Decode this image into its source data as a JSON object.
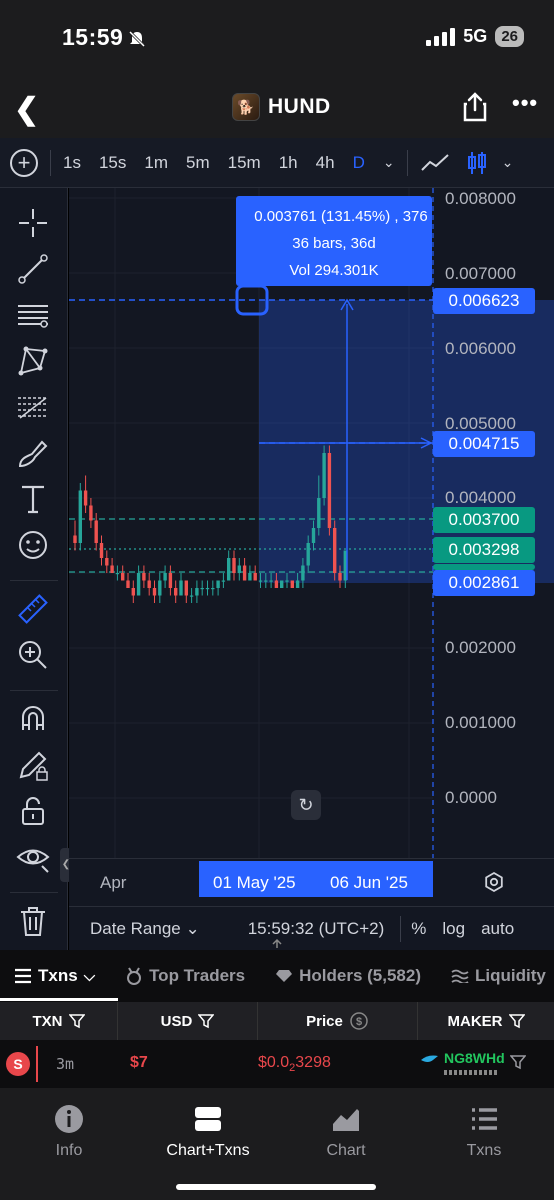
{
  "status": {
    "time": "15:59",
    "network": "5G",
    "battery": "26"
  },
  "header": {
    "token_name": "HUND"
  },
  "timeframes": {
    "items": [
      "1s",
      "15s",
      "1m",
      "5m",
      "15m",
      "1h",
      "4h",
      "D"
    ],
    "active": "D"
  },
  "chart": {
    "y_labels": [
      "0.008000",
      "0.007000",
      "0.006000",
      "0.005000",
      "0.004000",
      "0.002000",
      "0.001000",
      "0.0000"
    ],
    "price_tags": {
      "top": "0.006623",
      "mid": "0.004715",
      "green": "0.003700",
      "current": "0.003298",
      "bottom": "0.002861"
    },
    "measure": {
      "line1": "0.003761 (131.45%) , 376",
      "line2": "36 bars, 36d",
      "line3": "Vol 294.301K"
    },
    "x_labels": {
      "apr": "Apr",
      "start": "01 May '25",
      "end": "06 Jun '25"
    }
  },
  "chart_data": {
    "type": "candlestick",
    "ylim": [
      0,
      0.008
    ],
    "candles": [
      [
        0.0035,
        0.0037,
        0.0033,
        0.0034
      ],
      [
        0.0034,
        0.0042,
        0.0033,
        0.0041
      ],
      [
        0.0041,
        0.0043,
        0.0038,
        0.0039
      ],
      [
        0.0039,
        0.004,
        0.0036,
        0.0037
      ],
      [
        0.0037,
        0.0038,
        0.0033,
        0.0034
      ],
      [
        0.0034,
        0.0035,
        0.0031,
        0.0032
      ],
      [
        0.0032,
        0.0033,
        0.003,
        0.0031
      ],
      [
        0.0031,
        0.0032,
        0.003,
        0.003
      ],
      [
        0.003,
        0.0031,
        0.0029,
        0.003
      ],
      [
        0.003,
        0.0031,
        0.0029,
        0.0029
      ],
      [
        0.0029,
        0.003,
        0.0028,
        0.0028
      ],
      [
        0.0028,
        0.0029,
        0.0026,
        0.0027
      ],
      [
        0.0027,
        0.0031,
        0.0027,
        0.003
      ],
      [
        0.003,
        0.0031,
        0.0028,
        0.0029
      ],
      [
        0.0029,
        0.003,
        0.0027,
        0.0028
      ],
      [
        0.0028,
        0.0029,
        0.0026,
        0.0027
      ],
      [
        0.0027,
        0.003,
        0.0026,
        0.0029
      ],
      [
        0.0029,
        0.0031,
        0.0028,
        0.003
      ],
      [
        0.003,
        0.0031,
        0.0027,
        0.0028
      ],
      [
        0.0028,
        0.0029,
        0.0026,
        0.0027
      ],
      [
        0.0027,
        0.003,
        0.0027,
        0.0029
      ],
      [
        0.0029,
        0.0029,
        0.0026,
        0.0027
      ],
      [
        0.0027,
        0.0028,
        0.0026,
        0.0027
      ],
      [
        0.0027,
        0.0029,
        0.0026,
        0.0028
      ],
      [
        0.0028,
        0.0029,
        0.0027,
        0.0028
      ],
      [
        0.0028,
        0.0029,
        0.0027,
        0.0028
      ],
      [
        0.0028,
        0.0029,
        0.0027,
        0.0028
      ],
      [
        0.0028,
        0.0029,
        0.0027,
        0.0029
      ],
      [
        0.0029,
        0.003,
        0.0028,
        0.0029
      ],
      [
        0.0029,
        0.0033,
        0.0029,
        0.0032
      ],
      [
        0.0032,
        0.0033,
        0.0029,
        0.003
      ],
      [
        0.003,
        0.0032,
        0.0029,
        0.0031
      ],
      [
        0.0031,
        0.0032,
        0.0029,
        0.0029
      ],
      [
        0.0029,
        0.0031,
        0.0029,
        0.003
      ],
      [
        0.003,
        0.0031,
        0.0029,
        0.0029
      ],
      [
        0.0029,
        0.003,
        0.0028,
        0.0029
      ],
      [
        0.0029,
        0.003,
        0.0028,
        0.0029
      ],
      [
        0.0029,
        0.003,
        0.0028,
        0.0029
      ],
      [
        0.0029,
        0.003,
        0.0028,
        0.0028
      ],
      [
        0.0028,
        0.0029,
        0.0028,
        0.0029
      ],
      [
        0.0029,
        0.003,
        0.0028,
        0.0029
      ],
      [
        0.0029,
        0.0029,
        0.0028,
        0.0028
      ],
      [
        0.0028,
        0.003,
        0.0028,
        0.0029
      ],
      [
        0.0029,
        0.0032,
        0.0028,
        0.0031
      ],
      [
        0.0031,
        0.0035,
        0.003,
        0.0034
      ],
      [
        0.0034,
        0.0037,
        0.0033,
        0.0036
      ],
      [
        0.0036,
        0.0043,
        0.0035,
        0.004
      ],
      [
        0.004,
        0.0047,
        0.0039,
        0.0046
      ],
      [
        0.0046,
        0.0047,
        0.0035,
        0.0036
      ],
      [
        0.0036,
        0.0037,
        0.0029,
        0.003
      ],
      [
        0.003,
        0.0031,
        0.0028,
        0.0029
      ],
      [
        0.0029,
        0.0033,
        0.0028,
        0.0033
      ]
    ]
  },
  "bottom_bar": {
    "range": "Date Range",
    "time": "15:59:32 (UTC+2)",
    "percent": "%",
    "log": "log",
    "auto": "auto"
  },
  "tabs": {
    "txns": "Txns",
    "traders": "Top Traders",
    "holders": "Holders (5,582)",
    "liquidity": "Liquidity"
  },
  "table": {
    "headers": [
      "TXN",
      "USD",
      "Price",
      "MAKER"
    ],
    "row": {
      "type": "S",
      "age": "3m",
      "usd": "$7",
      "price_prefix": "$0.0",
      "price_zeros": "2",
      "price_digits": "3298",
      "maker": "NG8WHd"
    }
  },
  "bottom_nav": {
    "info": "Info",
    "chart_txns": "Chart+Txns",
    "chart": "Chart",
    "txns": "Txns"
  },
  "colors": {
    "up": "#26a69a",
    "down": "#ef5350",
    "accent": "#2962ff"
  }
}
